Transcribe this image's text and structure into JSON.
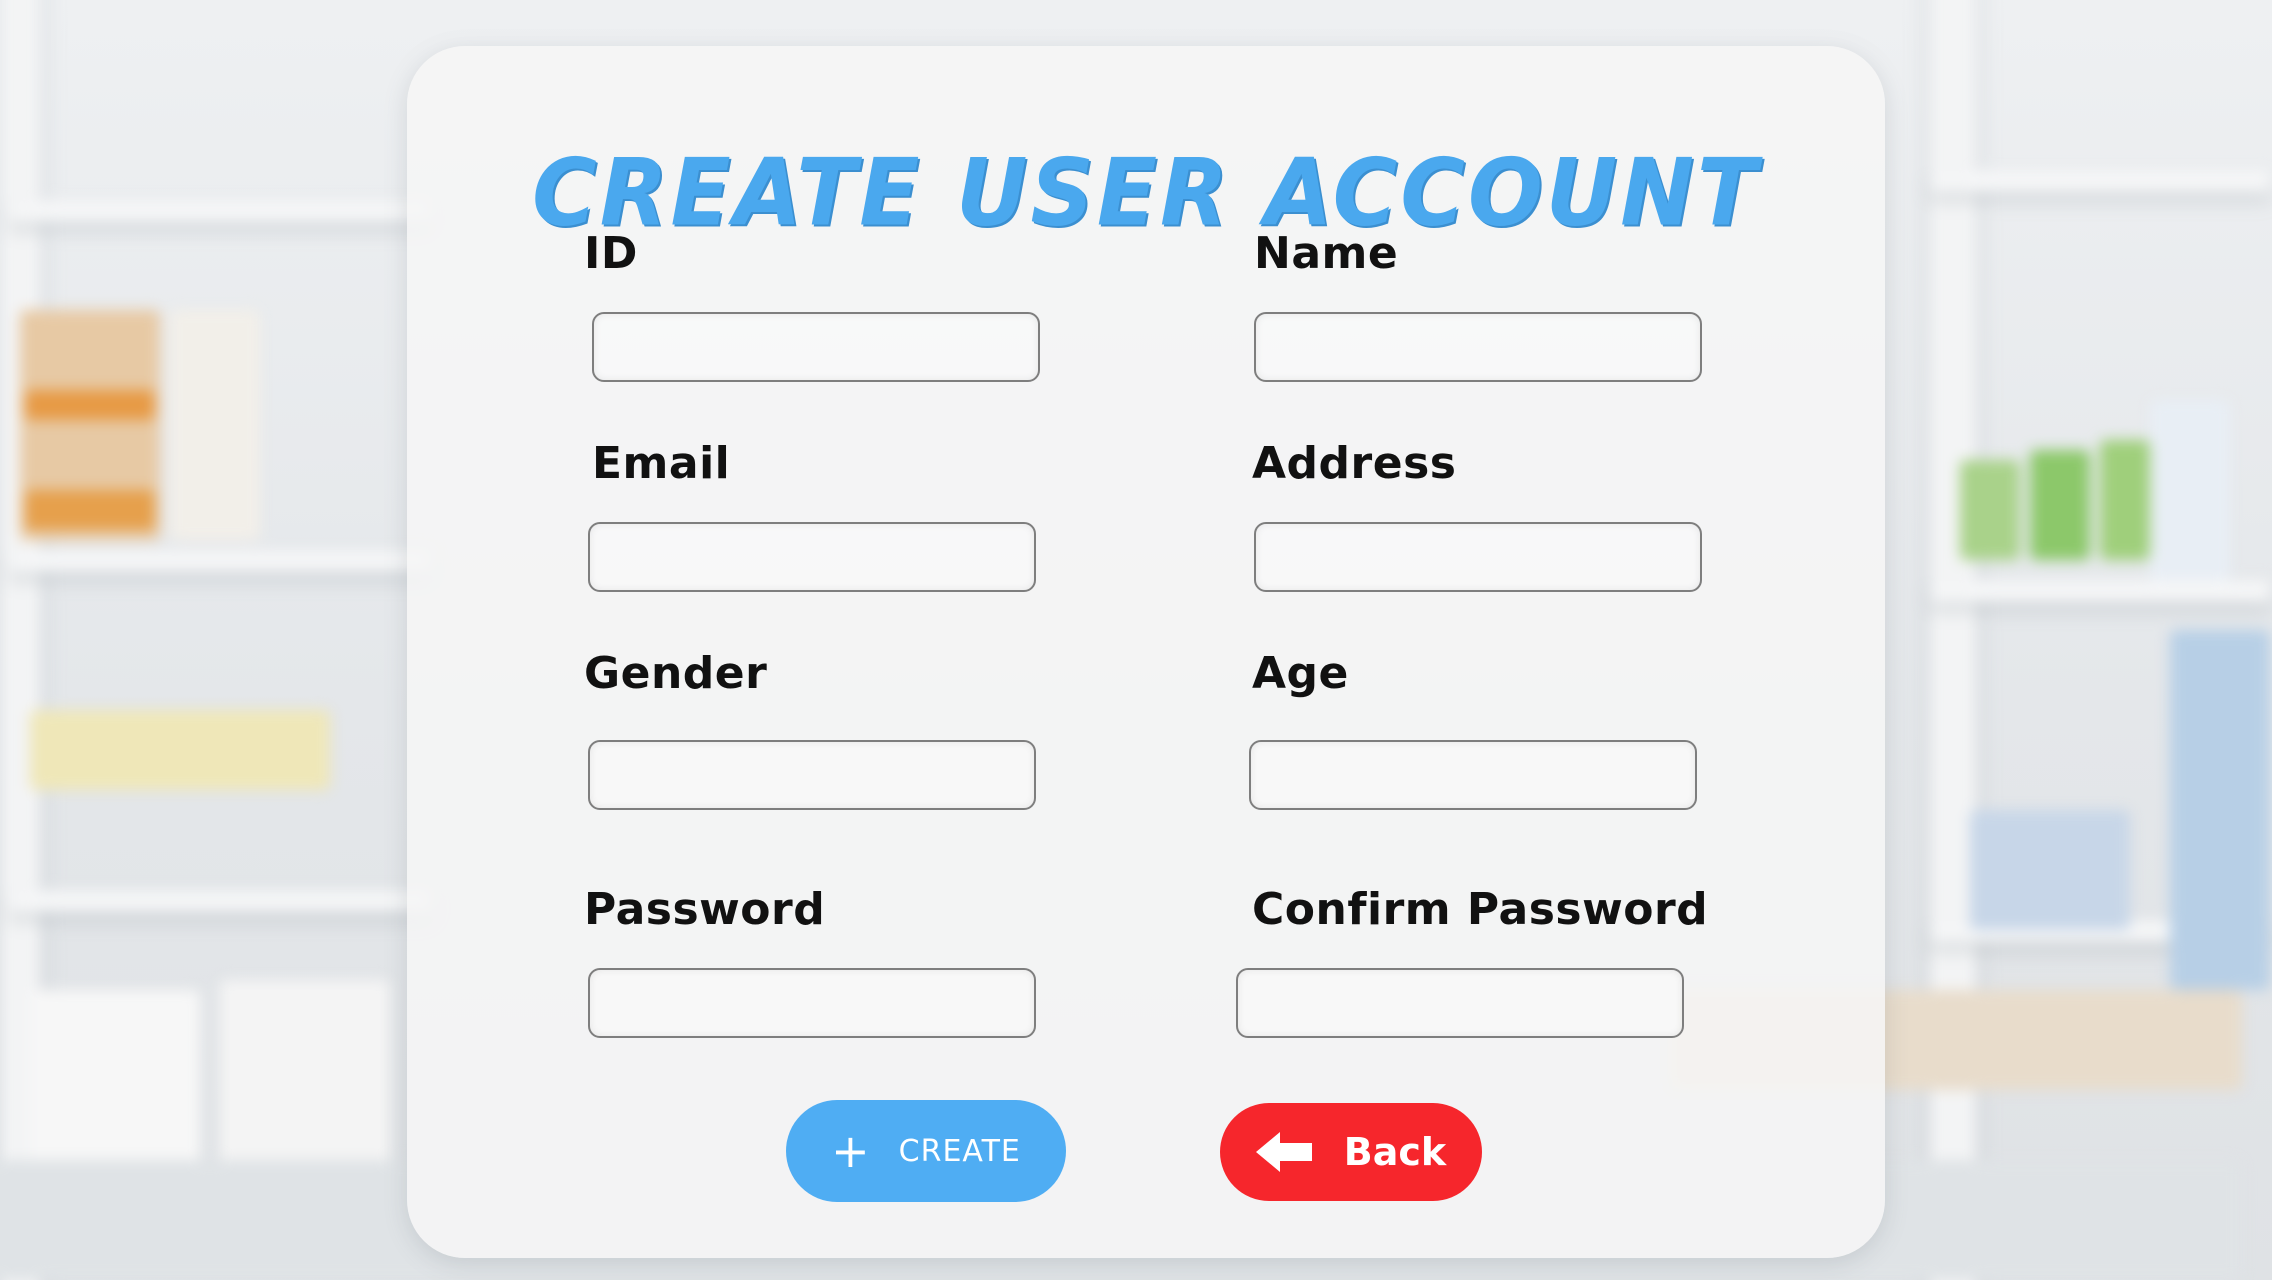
{
  "form": {
    "title": "CREATE USER ACCOUNT",
    "fields": [
      {
        "label": "ID",
        "value": "",
        "placeholder": ""
      },
      {
        "label": "Name",
        "value": "",
        "placeholder": ""
      },
      {
        "label": "Email",
        "value": "",
        "placeholder": ""
      },
      {
        "label": "Address",
        "value": "",
        "placeholder": ""
      },
      {
        "label": "Gender",
        "value": "",
        "placeholder": ""
      },
      {
        "label": "Age",
        "value": "",
        "placeholder": ""
      },
      {
        "label": "Password",
        "value": "",
        "placeholder": ""
      },
      {
        "label": "Confirm Password",
        "value": "",
        "placeholder": ""
      }
    ]
  },
  "buttons": {
    "create_label": "CREATE",
    "create_icon": "plus-icon",
    "back_label": "Back",
    "back_icon": "arrow-left-icon"
  },
  "colors": {
    "title": "#4aa8ee",
    "create_button": "#4fadf3",
    "back_button": "#f6262c"
  }
}
